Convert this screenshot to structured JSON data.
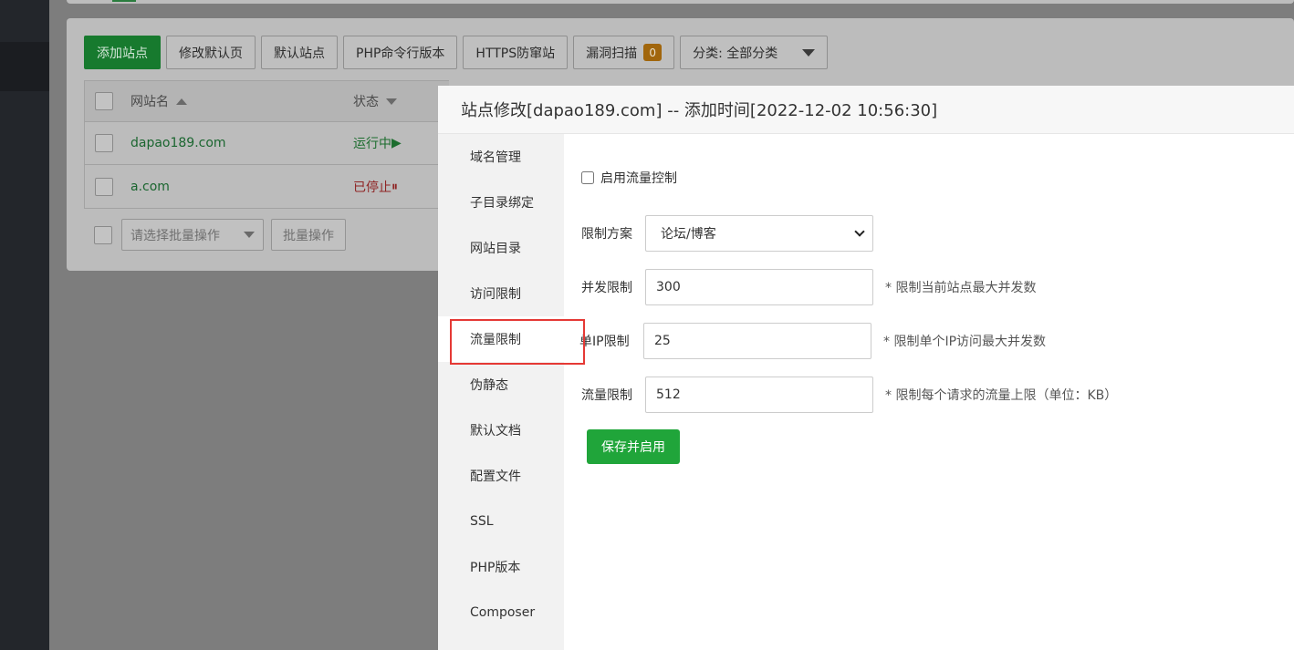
{
  "toolbar": {
    "add_site": "添加站点",
    "modify_default_page": "修改默认页",
    "default_site": "默认站点",
    "php_cli_version": "PHP命令行版本",
    "https_anti_theft": "HTTPS防窜站",
    "vuln_scan": "漏洞扫描",
    "vuln_count": "0",
    "category_select": "分类: 全部分类"
  },
  "table": {
    "headers": {
      "site_name": "网站名",
      "status": "状态"
    },
    "rows": [
      {
        "name": "dapao189.com",
        "status": "运行中",
        "status_icon": "▶"
      },
      {
        "name": "a.com",
        "status": "已停止",
        "status_icon": "⏸"
      }
    ]
  },
  "bulk": {
    "select_placeholder": "请选择批量操作",
    "button": "批量操作"
  },
  "modal": {
    "title": "站点修改[dapao189.com] -- 添加时间[2022-12-02 10:56:30]",
    "tabs": [
      {
        "label": "域名管理"
      },
      {
        "label": "子目录绑定"
      },
      {
        "label": "网站目录"
      },
      {
        "label": "访问限制"
      },
      {
        "label": "流量限制"
      },
      {
        "label": "伪静态"
      },
      {
        "label": "默认文档"
      },
      {
        "label": "配置文件"
      },
      {
        "label": "SSL"
      },
      {
        "label": "PHP版本"
      },
      {
        "label": "Composer"
      }
    ],
    "active_tab": "流量限制",
    "form": {
      "enable_label": "启用流量控制",
      "enable_checked": false,
      "plan_label": "限制方案",
      "plan_value": "论坛/博客",
      "concurrency_label": "并发限制",
      "concurrency_value": "300",
      "concurrency_hint": "* 限制当前站点最大并发数",
      "per_ip_label": "单IP限制",
      "per_ip_value": "25",
      "per_ip_hint": "* 限制单个IP访问最大并发数",
      "rate_label": "流量限制",
      "rate_value": "512",
      "rate_hint": "* 限制每个请求的流量上限（单位：KB）",
      "save_button": "保存并启用"
    }
  },
  "colors": {
    "primary_green": "#20a53a",
    "highlight_red": "#e53935"
  }
}
